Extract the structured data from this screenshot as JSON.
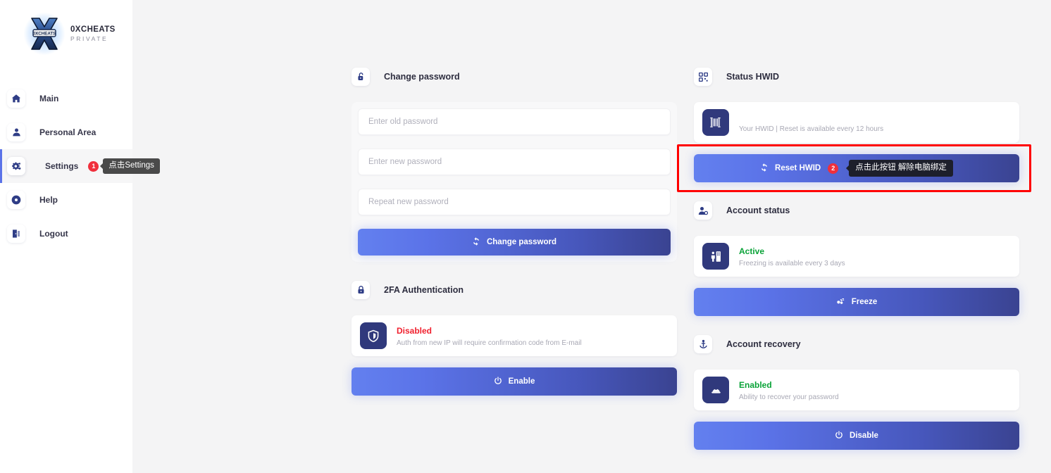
{
  "brand": {
    "title": "0XCHEATS",
    "subtitle": "PRIVATE",
    "logo_icon": "x-shield-logo"
  },
  "sidebar": {
    "items": [
      {
        "label": "Main",
        "icon": "home-icon",
        "active": false
      },
      {
        "label": "Personal Area",
        "icon": "user-icon",
        "active": false
      },
      {
        "label": "Settings",
        "icon": "gears-icon",
        "active": true,
        "badge": "1",
        "tooltip": "点击Settings"
      },
      {
        "label": "Help",
        "icon": "life-ring-icon",
        "active": false
      },
      {
        "label": "Logout",
        "icon": "logout-door-icon",
        "active": false
      }
    ]
  },
  "left_column": {
    "change_password": {
      "title": "Change password",
      "icon": "unlock-icon",
      "fields": {
        "old_password_placeholder": "Enter old password",
        "new_password_placeholder": "Enter new password",
        "repeat_password_placeholder": "Repeat new password"
      },
      "submit_label": "Change password",
      "submit_icon": "refresh-icon"
    },
    "two_factor": {
      "title": "2FA Authentication",
      "icon": "lock-icon",
      "status": "Disabled",
      "status_color": "#f0202e",
      "description": "Auth from new IP will require confirmation code from E-mail",
      "card_icon": "shield-icon",
      "action_label": "Enable",
      "action_icon": "power-icon"
    }
  },
  "right_column": {
    "status_hwid": {
      "title": "Status HWID",
      "icon": "qr-grid-icon",
      "card_icon": "barcode-icon",
      "hwid_value_redacted": true,
      "description": "Your HWID | Reset is available every 12 hours",
      "action_label": "Reset HWID",
      "action_icon": "refresh-icon",
      "badge": "2",
      "tooltip": "点击此按钮 解除电脑绑定",
      "highlight_color": "#ff0000"
    },
    "account_status": {
      "title": "Account status",
      "icon": "user-gear-icon",
      "card_icon": "building-icon",
      "status": "Active",
      "status_color": "#0aa338",
      "description": "Freezing is available every 3 days",
      "action_label": "Freeze",
      "action_icon": "snowflake-icon"
    },
    "account_recovery": {
      "title": "Account recovery",
      "icon": "anchor-icon",
      "card_icon": "lifebuoy-icon",
      "status": "Enabled",
      "status_color": "#0aa338",
      "description": "Ability to recover your password",
      "action_label": "Disable",
      "action_icon": "power-icon"
    }
  },
  "theme": {
    "accent_start": "#6380ef",
    "accent_end": "#3a4391",
    "page_bg": "#f4f4f5",
    "sidebar_bg": "#ffffff",
    "icon_navy": "#30397c"
  }
}
